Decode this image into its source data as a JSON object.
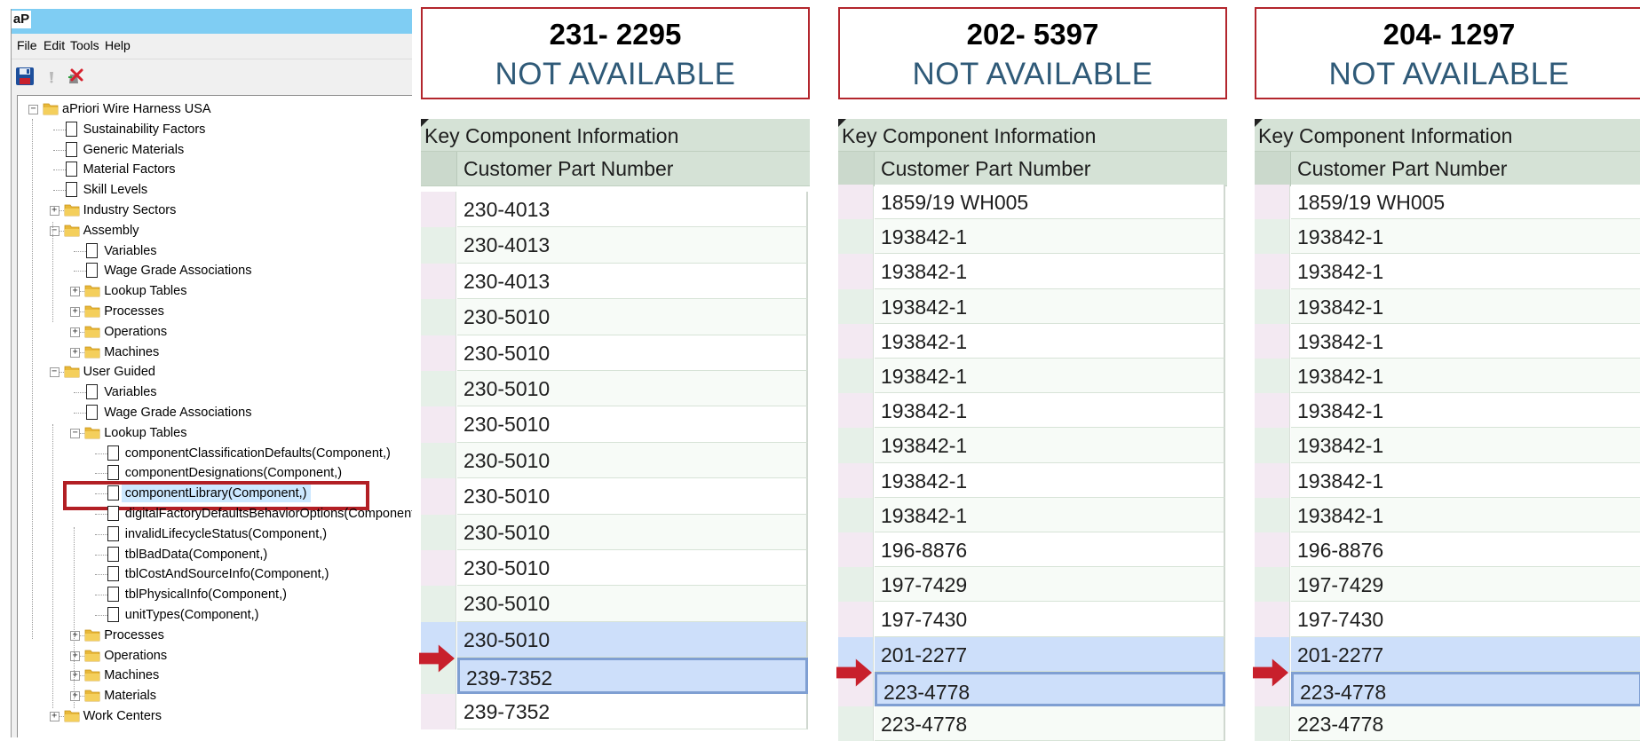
{
  "app": {
    "logo": "aP",
    "menu": [
      "File",
      "Edit",
      "Tools",
      "Help"
    ],
    "toolbar_icons": [
      "save-icon",
      "disabled-icon",
      "delete-icon"
    ],
    "tree": [
      {
        "label": "aPriori Wire Harness USA",
        "level": 0,
        "type": "folder",
        "expander": "-"
      },
      {
        "label": "Sustainability Factors",
        "level": 1,
        "type": "doc"
      },
      {
        "label": "Generic Materials",
        "level": 1,
        "type": "doc"
      },
      {
        "label": "Material Factors",
        "level": 1,
        "type": "doc"
      },
      {
        "label": "Skill Levels",
        "level": 1,
        "type": "doc"
      },
      {
        "label": "Industry Sectors",
        "level": 1,
        "type": "folder",
        "expander": "+"
      },
      {
        "label": "Assembly",
        "level": 1,
        "type": "folder",
        "expander": "-"
      },
      {
        "label": "Variables",
        "level": 2,
        "type": "doc"
      },
      {
        "label": "Wage Grade Associations",
        "level": 2,
        "type": "doc"
      },
      {
        "label": "Lookup Tables",
        "level": 2,
        "type": "folder",
        "expander": "+"
      },
      {
        "label": "Processes",
        "level": 2,
        "type": "folder",
        "expander": "+"
      },
      {
        "label": "Operations",
        "level": 2,
        "type": "folder",
        "expander": "+"
      },
      {
        "label": "Machines",
        "level": 2,
        "type": "folder",
        "expander": "+"
      },
      {
        "label": "User Guided",
        "level": 1,
        "type": "folder",
        "expander": "-"
      },
      {
        "label": "Variables",
        "level": 2,
        "type": "doc"
      },
      {
        "label": "Wage Grade Associations",
        "level": 2,
        "type": "doc"
      },
      {
        "label": "Lookup Tables",
        "level": 2,
        "type": "folder",
        "expander": "-"
      },
      {
        "label": "componentClassificationDefaults(Component,)",
        "level": 3,
        "type": "doc"
      },
      {
        "label": "componentDesignations(Component,)",
        "level": 3,
        "type": "doc"
      },
      {
        "label": "componentLibrary(Component,)",
        "level": 3,
        "type": "doc",
        "selected": true
      },
      {
        "label": "digitalFactoryDefaultsBehaviorOptions(Component,)",
        "level": 3,
        "type": "doc"
      },
      {
        "label": "invalidLifecycleStatus(Component,)",
        "level": 3,
        "type": "doc"
      },
      {
        "label": "tblBadData(Component,)",
        "level": 3,
        "type": "doc"
      },
      {
        "label": "tblCostAndSourceInfo(Component,)",
        "level": 3,
        "type": "doc"
      },
      {
        "label": "tblPhysicalInfo(Component,)",
        "level": 3,
        "type": "doc"
      },
      {
        "label": "unitTypes(Component,)",
        "level": 3,
        "type": "doc"
      },
      {
        "label": "Processes",
        "level": 2,
        "type": "folder",
        "expander": "+"
      },
      {
        "label": "Operations",
        "level": 2,
        "type": "folder",
        "expander": "+"
      },
      {
        "label": "Machines",
        "level": 2,
        "type": "folder",
        "expander": "+"
      },
      {
        "label": "Materials",
        "level": 2,
        "type": "folder",
        "expander": "+"
      },
      {
        "label": "Work Centers",
        "level": 1,
        "type": "folder",
        "expander": "+"
      }
    ]
  },
  "panels": [
    {
      "number": "231- 2295",
      "status": "NOT AVAILABLE",
      "grid_title": "Key Component Information",
      "column_header": "Customer Part Number",
      "rows": [
        "230-4013",
        "230-4013",
        "230-4013",
        "230-5010",
        "230-5010",
        "230-5010",
        "230-5010",
        "230-5010",
        "230-5010",
        "230-5010",
        "230-5010",
        "230-5010",
        "230-5010",
        "239-7352",
        "239-7352"
      ],
      "selected_index": 12,
      "current_index": 13
    },
    {
      "number": "202- 5397",
      "status": "NOT AVAILABLE",
      "grid_title": "Key Component Information",
      "column_header": "Customer Part Number",
      "rows": [
        "1859/19 WH005",
        "193842-1",
        "193842-1",
        "193842-1",
        "193842-1",
        "193842-1",
        "193842-1",
        "193842-1",
        "193842-1",
        "193842-1",
        "196-8876",
        "197-7429",
        "197-7430",
        "201-2277",
        "223-4778",
        "223-4778"
      ],
      "selected_index": 13,
      "current_index": 14
    },
    {
      "number": "204- 1297",
      "status": "NOT AVAILABLE",
      "grid_title": "Key Component Information",
      "column_header": "Customer Part Number",
      "rows": [
        "1859/19 WH005",
        "193842-1",
        "193842-1",
        "193842-1",
        "193842-1",
        "193842-1",
        "193842-1",
        "193842-1",
        "193842-1",
        "193842-1",
        "196-8876",
        "197-7429",
        "197-7430",
        "201-2277",
        "223-4778",
        "223-4778"
      ],
      "selected_index": 13,
      "current_index": 14
    }
  ],
  "colors": {
    "title_bar": "#7fcdf3",
    "highlight_border": "#b21f24",
    "status_text": "#2f5a78",
    "grid_header": "#d5e2d6",
    "selection": "#cddffa",
    "arrow": "#c8202c"
  }
}
